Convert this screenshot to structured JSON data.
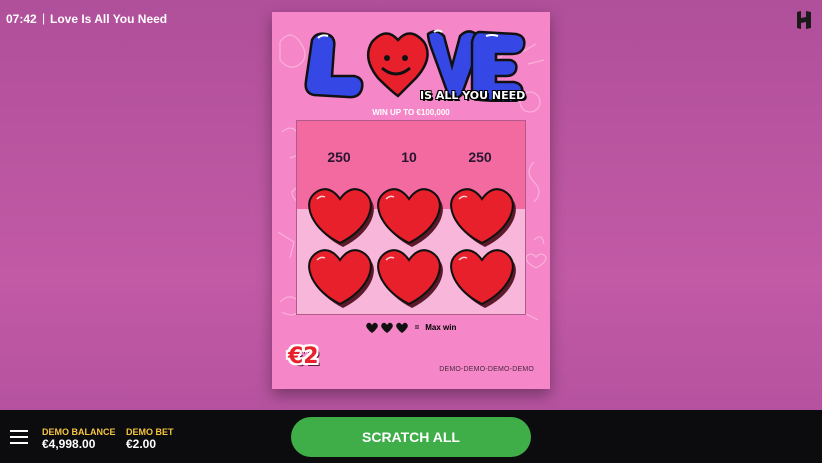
{
  "header": {
    "time": "07:42",
    "separator": "|",
    "game_title": "Love Is All You Need",
    "brand_logo_icon": "hacksaw-h-logo-icon"
  },
  "ticket": {
    "logo_word": "LOVE",
    "tagline": "IS ALL YOU NEED",
    "win_up_to": "WIN UP TO €100,000",
    "prizes": [
      "250",
      "10",
      "250"
    ],
    "hearts_count": 6,
    "legend": {
      "icons": [
        "heart-icon",
        "heart-icon",
        "heart-icon"
      ],
      "equals": "=",
      "text": "Max win"
    },
    "price": "€2",
    "watermark": "DEMO-DEMO-DEMO-DEMO"
  },
  "footer": {
    "menu_icon": "hamburger-menu-icon",
    "balance_label": "DEMO BALANCE",
    "balance_value": "€4,998.00",
    "bet_label": "DEMO BET",
    "bet_value": "€2.00",
    "scratch_button": "SCRATCH ALL"
  },
  "colors": {
    "background": "#c25aa6",
    "ticket": "#f586c8",
    "prize_band": "#f26aa0",
    "heart_red": "#e8202c",
    "logo_blue": "#3548e6",
    "button_green": "#3fae49",
    "label_yellow": "#f5c542"
  }
}
